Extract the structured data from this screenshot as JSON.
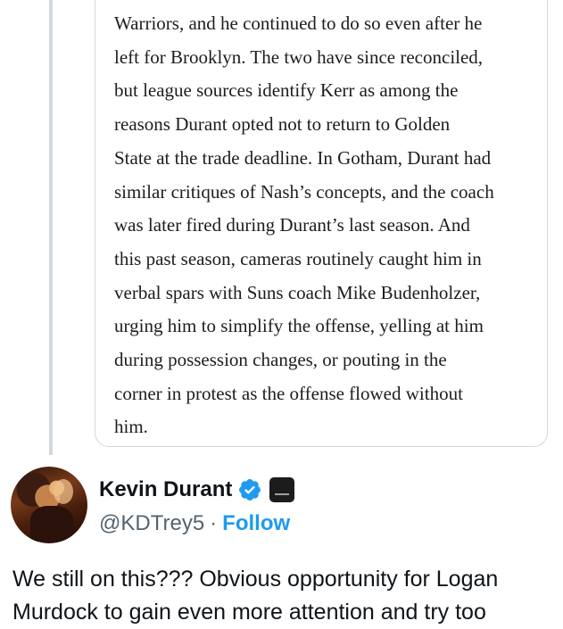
{
  "quoted_article": {
    "lines": [
      "Warriors, and he continued to do so even after he",
      "left for Brooklyn. The two have since reconciled,",
      "but league sources identify Kerr as among the",
      "reasons Durant opted not to return to Golden",
      "State at the trade deadline. In Gotham, Durant had",
      "similar critiques of Nash’s concepts, and the coach",
      "was later fired during Durant’s last season. And",
      "this past season, cameras routinely caught him in",
      "verbal spars with Suns coach Mike Budenholzer,",
      "urging him to simplify the offense, yelling at him",
      "during possession changes, or pouting in the",
      "corner in protest as the offense flowed without",
      "him."
    ]
  },
  "tweet": {
    "author_name": "Kevin Durant",
    "handle": "@KDTrey5",
    "separator": "·",
    "follow_label": "Follow",
    "verified_color": "#1d9bf0",
    "text_lines": [
      "We still on this??? Obvious opportunity for Logan",
      "Murdock to gain even more attention and try too"
    ]
  }
}
